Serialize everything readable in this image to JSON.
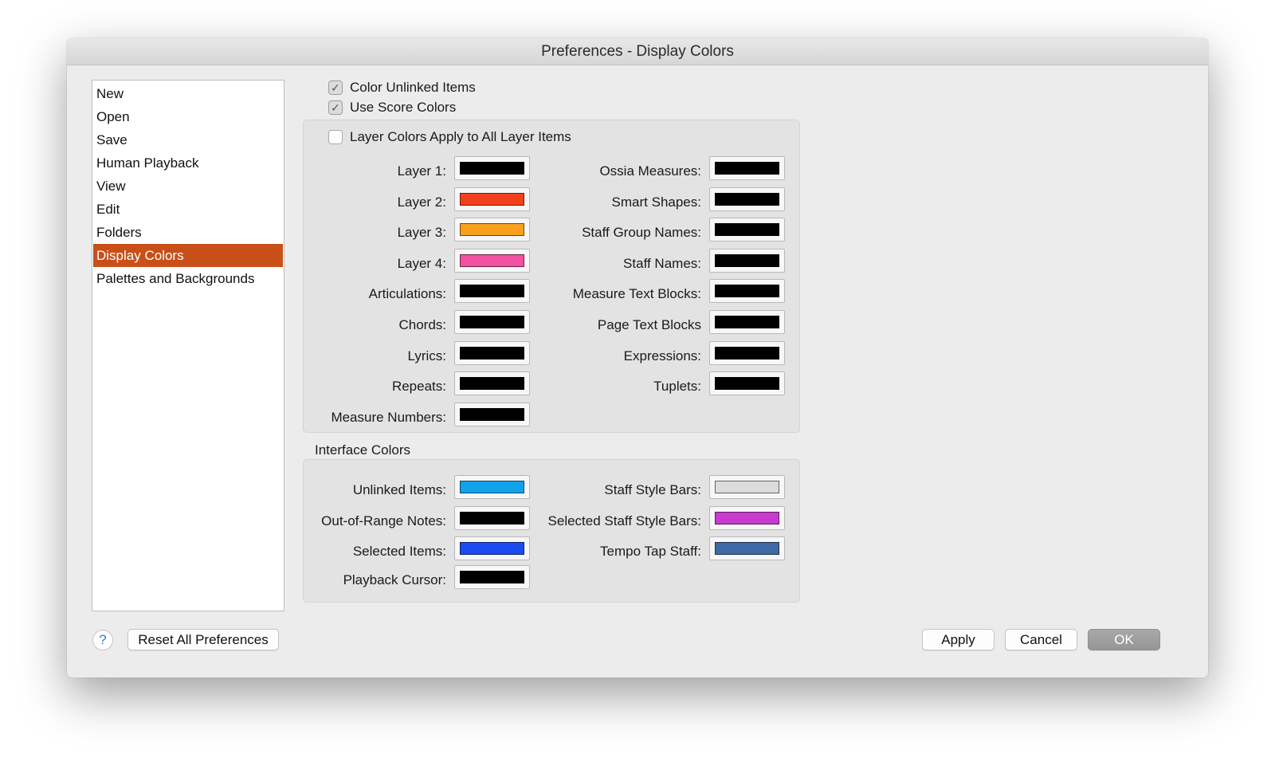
{
  "window": {
    "title": "Preferences - Display Colors"
  },
  "sidebar": {
    "items": [
      {
        "label": "New"
      },
      {
        "label": "Open"
      },
      {
        "label": "Save"
      },
      {
        "label": "Human Playback"
      },
      {
        "label": "View"
      },
      {
        "label": "Edit"
      },
      {
        "label": "Folders"
      },
      {
        "label": "Display Colors",
        "selected": true
      },
      {
        "label": "Palettes and Backgrounds"
      }
    ]
  },
  "options": {
    "color_unlinked": {
      "label": "Color Unlinked Items",
      "checked": true
    },
    "use_score_colors": {
      "label": "Use Score Colors",
      "checked": true
    },
    "layer_colors_all": {
      "label": "Layer Colors Apply to All Layer Items",
      "checked": false
    }
  },
  "score_colors": {
    "left": [
      {
        "label": "Layer 1:",
        "color": "#000000"
      },
      {
        "label": "Layer 2:",
        "color": "#f2401a"
      },
      {
        "label": "Layer 3:",
        "color": "#f9a01c"
      },
      {
        "label": "Layer 4:",
        "color": "#f250a0"
      },
      {
        "label": "Articulations:",
        "color": "#000000"
      },
      {
        "label": "Chords:",
        "color": "#000000"
      },
      {
        "label": "Lyrics:",
        "color": "#000000"
      },
      {
        "label": "Repeats:",
        "color": "#000000"
      },
      {
        "label": "Measure Numbers:",
        "color": "#000000"
      }
    ],
    "right": [
      {
        "label": "Ossia Measures:",
        "color": "#000000"
      },
      {
        "label": "Smart Shapes:",
        "color": "#000000"
      },
      {
        "label": "Staff Group Names:",
        "color": "#000000"
      },
      {
        "label": "Staff Names:",
        "color": "#000000"
      },
      {
        "label": "Measure Text Blocks:",
        "color": "#000000"
      },
      {
        "label": "Page Text Blocks",
        "color": "#000000"
      },
      {
        "label": "Expressions:",
        "color": "#000000"
      },
      {
        "label": "Tuplets:",
        "color": "#000000"
      }
    ]
  },
  "interface_colors": {
    "title": "Interface Colors",
    "left": [
      {
        "label": "Unlinked Items:",
        "color": "#12a2ea"
      },
      {
        "label": "Out-of-Range Notes:",
        "color": "#000000"
      },
      {
        "label": "Selected Items:",
        "color": "#1b4cf2"
      },
      {
        "label": "Playback Cursor:",
        "color": "#000000"
      }
    ],
    "right": [
      {
        "label": "Staff Style Bars:",
        "color": "#dcdcdc"
      },
      {
        "label": "Selected Staff Style Bars:",
        "color": "#c93ad0"
      },
      {
        "label": "Tempo Tap Staff:",
        "color": "#3f6aa6"
      }
    ]
  },
  "footer": {
    "help": "?",
    "reset": "Reset All Preferences",
    "apply": "Apply",
    "cancel": "Cancel",
    "ok": "OK"
  }
}
